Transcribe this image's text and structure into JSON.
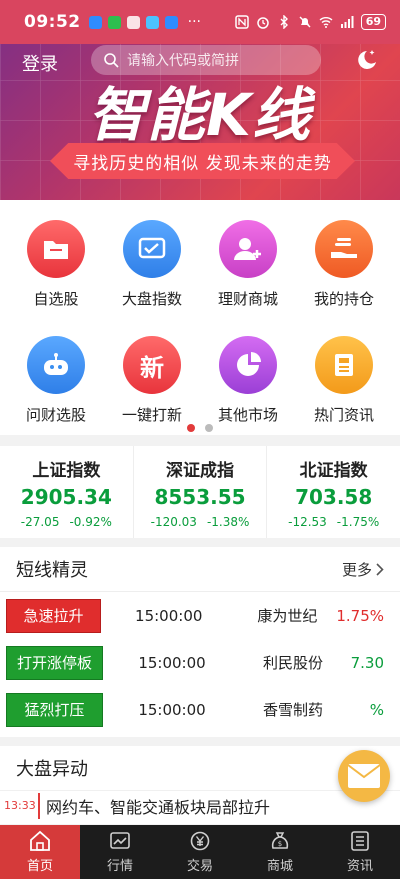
{
  "status_bar": {
    "time": "09:52",
    "more": "···",
    "battery": "69"
  },
  "header": {
    "login_label": "登录",
    "search_placeholder": "请输入代码或简拼"
  },
  "banner": {
    "title": "智能K线",
    "slogan": "寻找历史的相似  发现未来的走势"
  },
  "grid": {
    "items": [
      {
        "label": "自选股",
        "icon": "folder-icon",
        "color": "#f0474f"
      },
      {
        "label": "大盘指数",
        "icon": "chart-check-icon",
        "color": "#3a8ff0"
      },
      {
        "label": "理财商城",
        "icon": "user-plus-icon",
        "color": "#d94fd0"
      },
      {
        "label": "我的持仓",
        "icon": "hand-coins-icon",
        "color": "#f4652f"
      },
      {
        "label": "问财选股",
        "icon": "robot-icon",
        "color": "#3a8ff0"
      },
      {
        "label": "一键打新",
        "icon": "new-badge-icon",
        "color": "#f0474f",
        "glyph": "新"
      },
      {
        "label": "其他市场",
        "icon": "pie-chart-icon",
        "color": "#b84fe0"
      },
      {
        "label": "热门资讯",
        "icon": "news-icon",
        "color": "#f6a425"
      }
    ]
  },
  "indices": [
    {
      "name": "上证指数",
      "value": "2905.34",
      "change": "-27.05",
      "pct": "-0.92%"
    },
    {
      "name": "深证成指",
      "value": "8553.55",
      "change": "-120.03",
      "pct": "-1.38%"
    },
    {
      "name": "北证指数",
      "value": "703.58",
      "change": "-12.53",
      "pct": "-1.75%"
    }
  ],
  "genius": {
    "title": "短线精灵",
    "more": "更多",
    "rows": [
      {
        "tag": "急速拉升",
        "tag_color": "#e02d2d",
        "time": "15:00:00",
        "stock": "康为世纪",
        "pct": "1.75%",
        "pct_color": "#e02d2d"
      },
      {
        "tag": "打开涨停板",
        "tag_color": "#1f9e2f",
        "time": "15:00:00",
        "stock": "利民股份",
        "pct": "7.30",
        "pct_color": "#0a9d3c"
      },
      {
        "tag": "猛烈打压",
        "tag_color": "#1f9e2f",
        "time": "15:00:00",
        "stock": "香雪制药",
        "pct": "%",
        "pct_color": "#0a9d3c"
      }
    ]
  },
  "movement": {
    "title": "大盘异动",
    "news": [
      {
        "time": "13:33",
        "text": "网约车、智能交通板块局部拉升"
      }
    ]
  },
  "tabs": [
    {
      "label": "首页",
      "icon": "home-icon",
      "active": true
    },
    {
      "label": "行情",
      "icon": "market-chart-icon"
    },
    {
      "label": "交易",
      "icon": "yen-exchange-icon"
    },
    {
      "label": "商城",
      "icon": "money-bag-icon"
    },
    {
      "label": "资讯",
      "icon": "list-doc-icon"
    }
  ]
}
